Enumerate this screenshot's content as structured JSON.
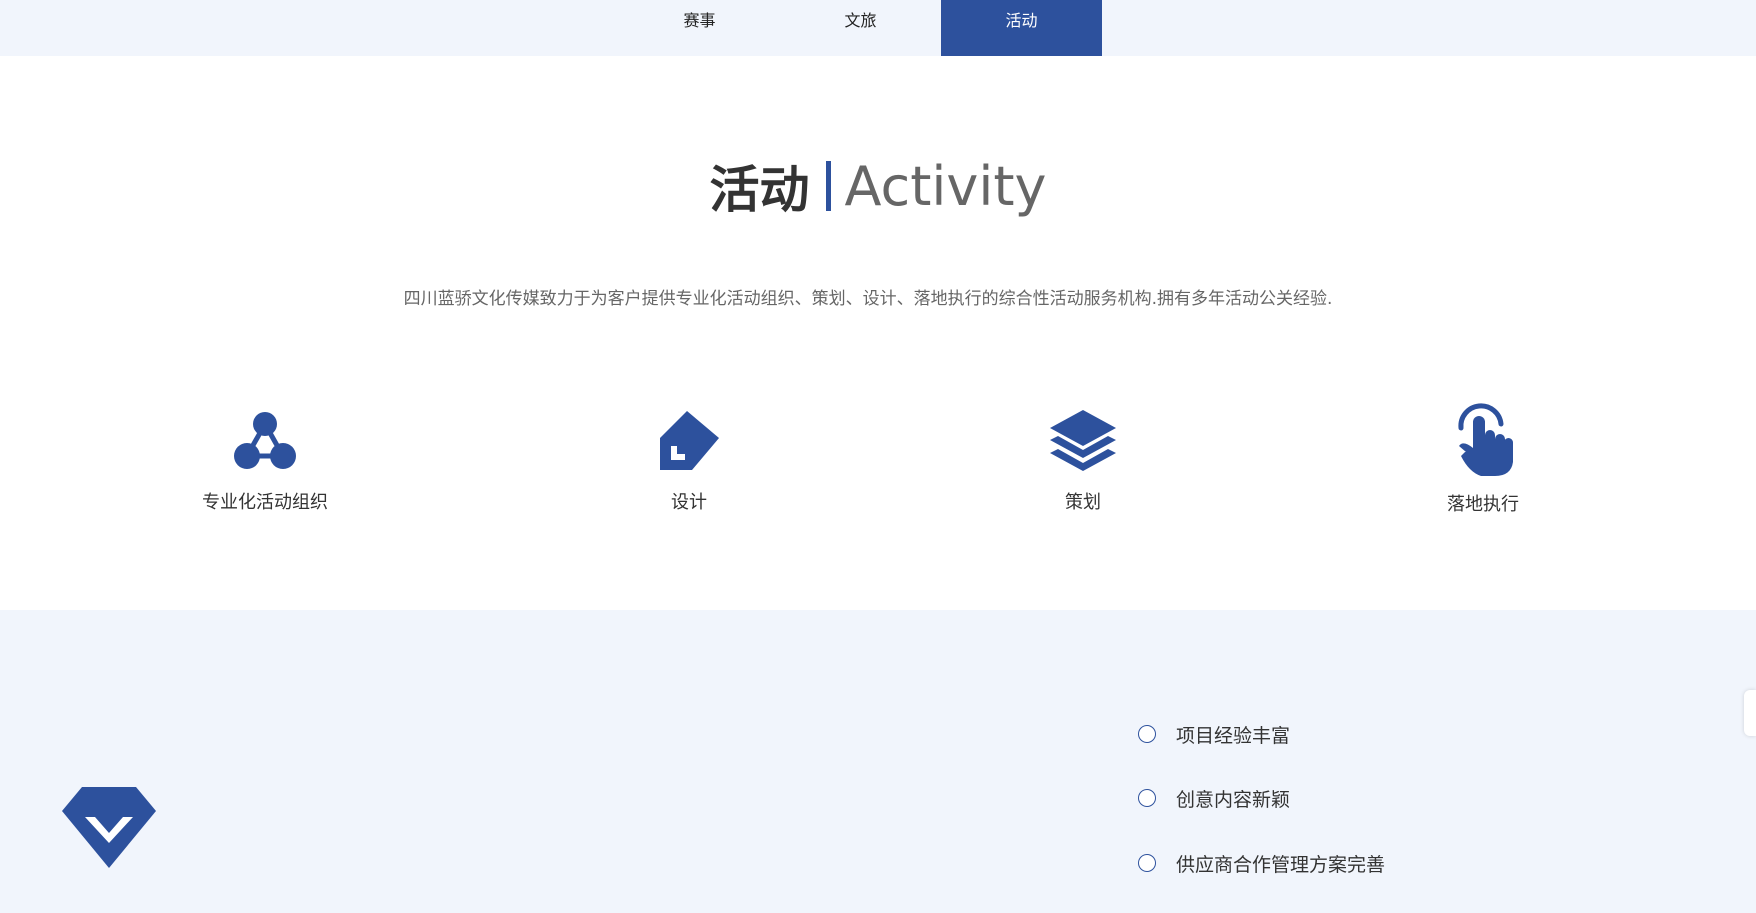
{
  "nav": {
    "tabs": [
      {
        "label": "赛事"
      },
      {
        "label": "文旅"
      },
      {
        "label": "活动",
        "active": true
      }
    ]
  },
  "section": {
    "title_cn": "活动",
    "title_en": "Activity",
    "description": "四川蓝骄文化传媒致力于为客户提供专业化活动组织、策划、设计、落地执行的综合性活动服务机构.拥有多年活动公关经验."
  },
  "features": [
    {
      "label": "专业化活动组织",
      "icon": "network-icon"
    },
    {
      "label": "设计",
      "icon": "pencil-icon"
    },
    {
      "label": "策划",
      "icon": "layers-icon"
    },
    {
      "label": "落地执行",
      "icon": "hand-pointer-icon"
    }
  ],
  "advantages": [
    {
      "text": "项目经验丰富"
    },
    {
      "text": "创意内容新颖"
    },
    {
      "text": "供应商合作管理方案完善"
    }
  ],
  "colors": {
    "brand": "#2d519d",
    "band_bg": "#f1f5fc"
  }
}
